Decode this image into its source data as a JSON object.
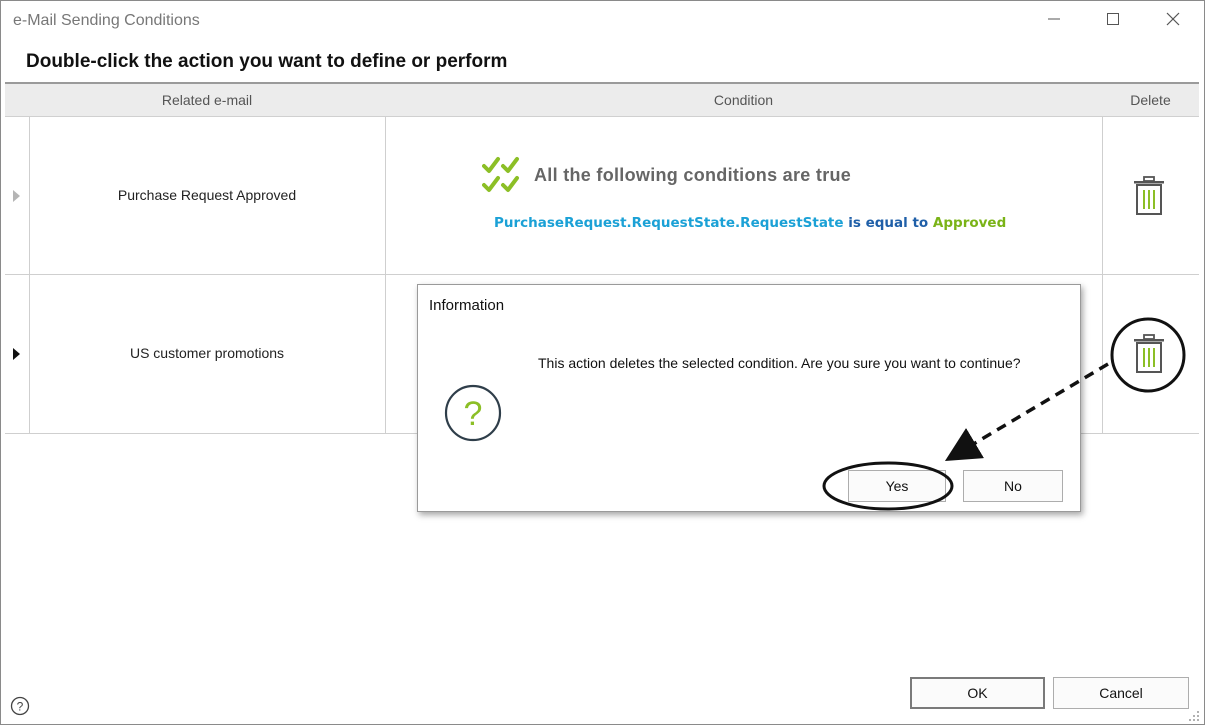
{
  "window": {
    "title": "e-Mail Sending Conditions",
    "heading": "Double-click the action you want to define or perform"
  },
  "grid": {
    "columns": [
      "Related e-mail",
      "Condition",
      "Delete"
    ],
    "rows": [
      {
        "email": "Purchase Request Approved",
        "condition_header": "All the following conditions are true",
        "condition_field": "PurchaseRequest.RequestState.RequestState",
        "condition_operator": "is equal to",
        "condition_value": "Approved"
      },
      {
        "email": "US customer promotions"
      }
    ]
  },
  "dialog": {
    "title": "Information",
    "message": "This action deletes the selected condition. Are you sure you want to continue?",
    "yes_label": "Yes",
    "no_label": "No",
    "icon": "question-icon"
  },
  "footer": {
    "ok_label": "OK",
    "cancel_label": "Cancel"
  },
  "colors": {
    "field_blue": "#1ba1d6",
    "operator_blue": "#1f5fa8",
    "value_green": "#7ab317",
    "check_green": "#8cbf26"
  }
}
